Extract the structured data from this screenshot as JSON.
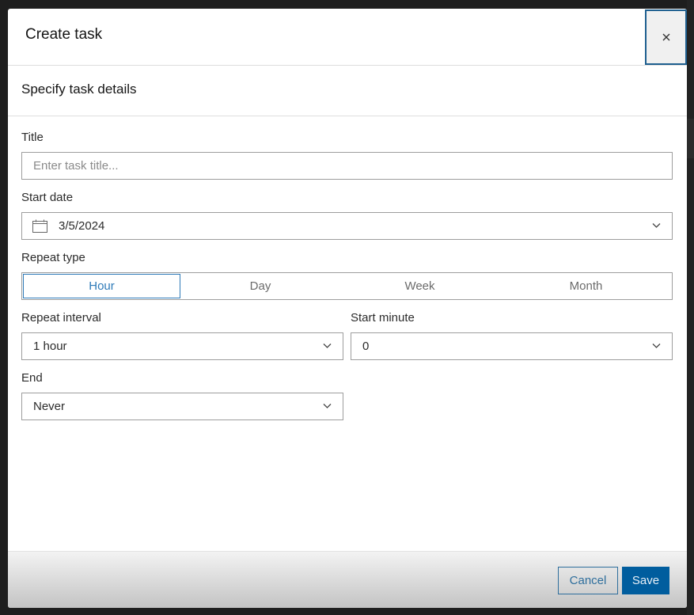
{
  "dialog": {
    "title": "Create task",
    "close_icon": "close-icon",
    "section_title": "Specify task details"
  },
  "form": {
    "title": {
      "label": "Title",
      "value": "",
      "placeholder": "Enter task title..."
    },
    "start_date": {
      "label": "Start date",
      "value": "3/5/2024",
      "icon": "calendar-icon"
    },
    "repeat_type": {
      "label": "Repeat type",
      "options": [
        "Hour",
        "Day",
        "Week",
        "Month"
      ],
      "selected": "Hour"
    },
    "repeat_interval": {
      "label": "Repeat interval",
      "value": "1 hour"
    },
    "start_minute": {
      "label": "Start minute",
      "value": "0"
    },
    "end": {
      "label": "End",
      "value": "Never"
    }
  },
  "footer": {
    "cancel_label": "Cancel",
    "save_label": "Save"
  },
  "colors": {
    "accent": "#2e7ab8",
    "primary_button": "#005d9e",
    "close_focus_border": "#1e5f8f"
  }
}
